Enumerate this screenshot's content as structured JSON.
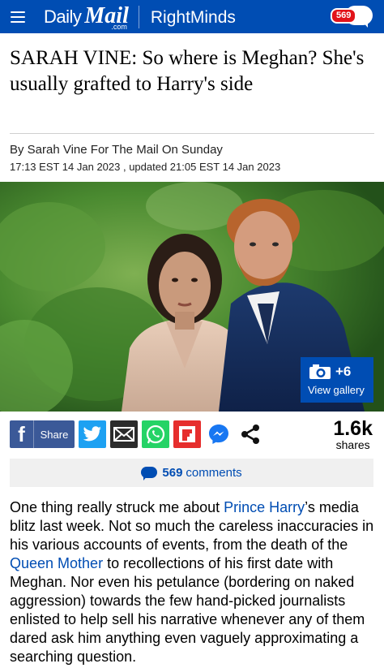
{
  "header": {
    "logo_daily": "Daily",
    "logo_mail": "Mail",
    "logo_com": ".com",
    "channel": "RightMinds",
    "comment_badge": "569"
  },
  "article": {
    "headline": "SARAH VINE: So where is Meghan? She's usually grafted to Harry's side",
    "byline": "By Sarah Vine For The Mail On Sunday",
    "dateline": "17:13 EST 14 Jan 2023 , updated 21:05 EST 14 Jan 2023"
  },
  "gallery": {
    "count_label": "+6",
    "view_label": "View gallery"
  },
  "share": {
    "facebook_label": "Share",
    "share_count": "1.6k",
    "shares_label": "shares"
  },
  "comments": {
    "count": "569",
    "label": "comments"
  },
  "body": {
    "p1_a": "One thing really struck me about ",
    "link_harry": "Prince Harry",
    "p1_b": "’s media blitz last week. Not so much the careless inaccuracies in his various accounts of events, from the death of the ",
    "link_queen_mother": "Queen Mother",
    "p1_c": " to recollections of his first date with Meghan. Nor even his petulance (bordering on naked aggression) towards the few hand-picked journalists enlisted to help sell his narrative whenever any of them dared ask him anything even vaguely approximating a searching question."
  },
  "colors": {
    "brand_blue": "#004db3",
    "badge_red": "#e2131a",
    "facebook": "#3b5998",
    "twitter": "#1da1f2",
    "whatsapp": "#25d366",
    "flipboard": "#e62e2d"
  },
  "icons": [
    "menu-icon",
    "comment-bubble-icon",
    "camera-icon",
    "facebook-icon",
    "twitter-icon",
    "email-icon",
    "whatsapp-icon",
    "flipboard-icon",
    "messenger-icon",
    "share-icon",
    "comment-icon"
  ]
}
